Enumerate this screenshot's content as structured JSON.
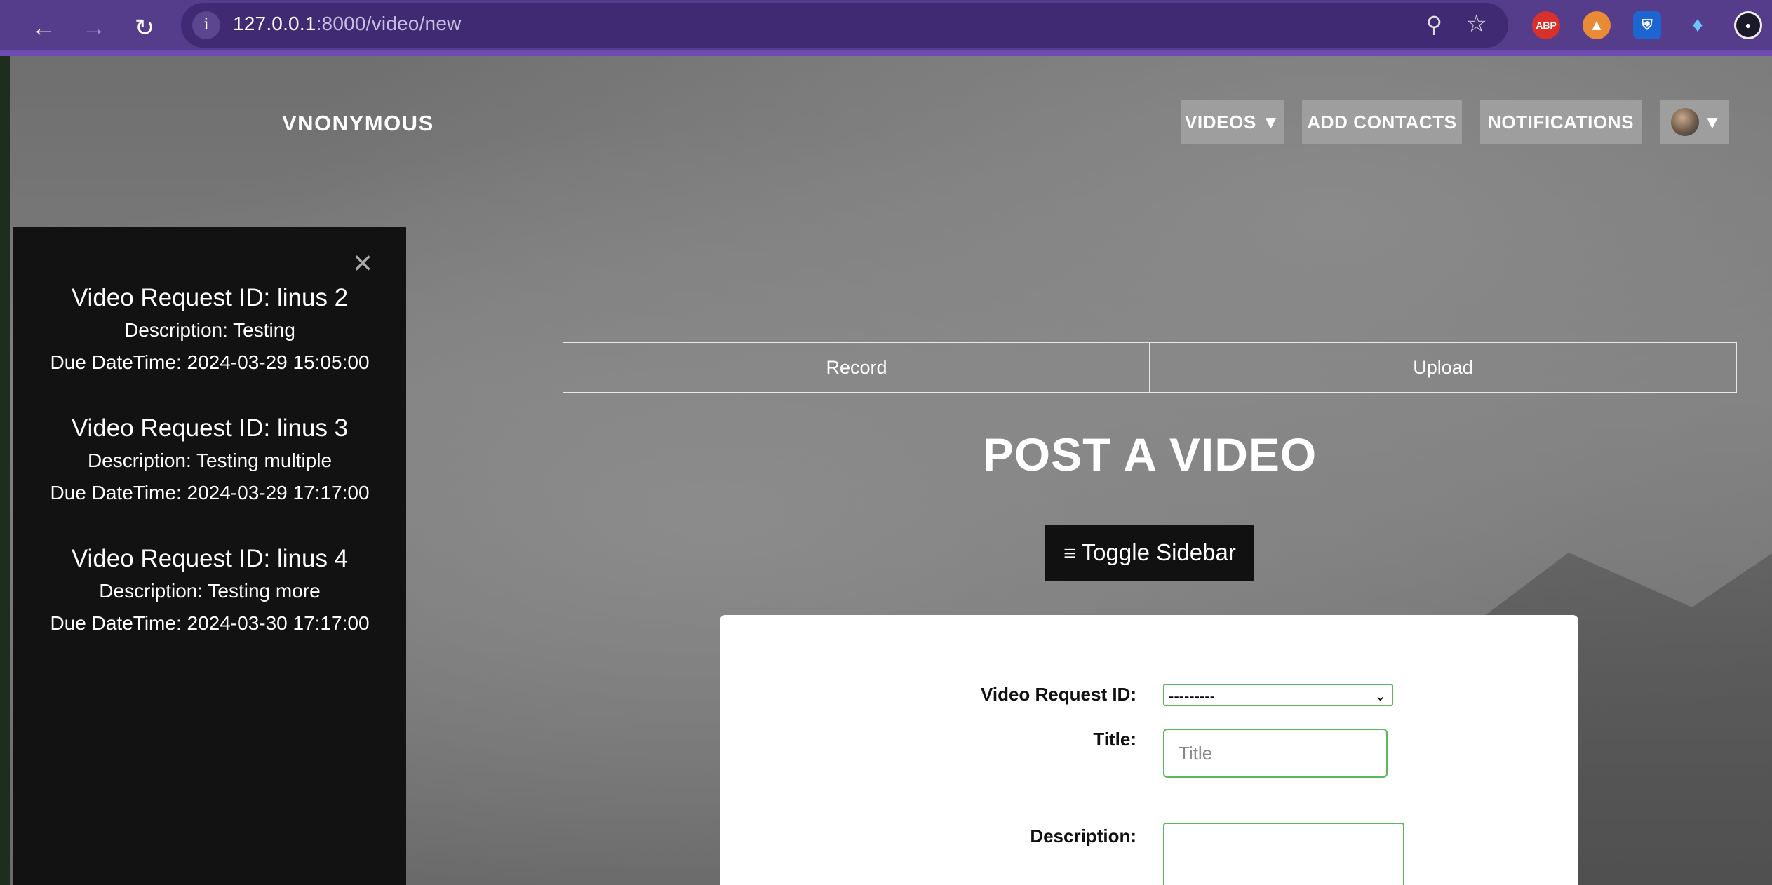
{
  "browser": {
    "url_host": "127.0.0.1",
    "url_path": ":8000/video/new",
    "extensions": [
      "adblock-icon",
      "metamask-icon",
      "bitwarden-icon",
      "gem-icon",
      "profile-icon"
    ],
    "abp_label": "ABP"
  },
  "brand": "VNONYMOUS",
  "nav": {
    "videos": "VIDEOS ▼",
    "add_contacts": "ADD CONTACTS",
    "notifications": "NOTIFICATIONS",
    "avatar_caret": "▼"
  },
  "sidebar": {
    "close": "×",
    "requests": [
      {
        "title": "Video Request ID: linus 2",
        "description": "Description: Testing",
        "due": "Due DateTime: 2024-03-29 15:05:00"
      },
      {
        "title": "Video Request ID: linus 3",
        "description": "Description: Testing multiple",
        "due": "Due DateTime: 2024-03-29 17:17:00"
      },
      {
        "title": "Video Request ID: linus 4",
        "description": "Description: Testing more",
        "due": "Due DateTime: 2024-03-30 17:17:00"
      }
    ]
  },
  "tabs": {
    "record": "Record",
    "upload": "Upload"
  },
  "heading": "POST A VIDEO",
  "toggle_sidebar": {
    "icon": "≡",
    "label": "Toggle Sidebar"
  },
  "form": {
    "request_label": "Video Request ID:",
    "request_value": "---------",
    "title_label": "Title:",
    "title_placeholder": "Title",
    "description_label": "Description:"
  },
  "colors": {
    "chrome": "#563d8c",
    "input_border": "#5cb85c",
    "sidebar_bg": "#121212"
  }
}
